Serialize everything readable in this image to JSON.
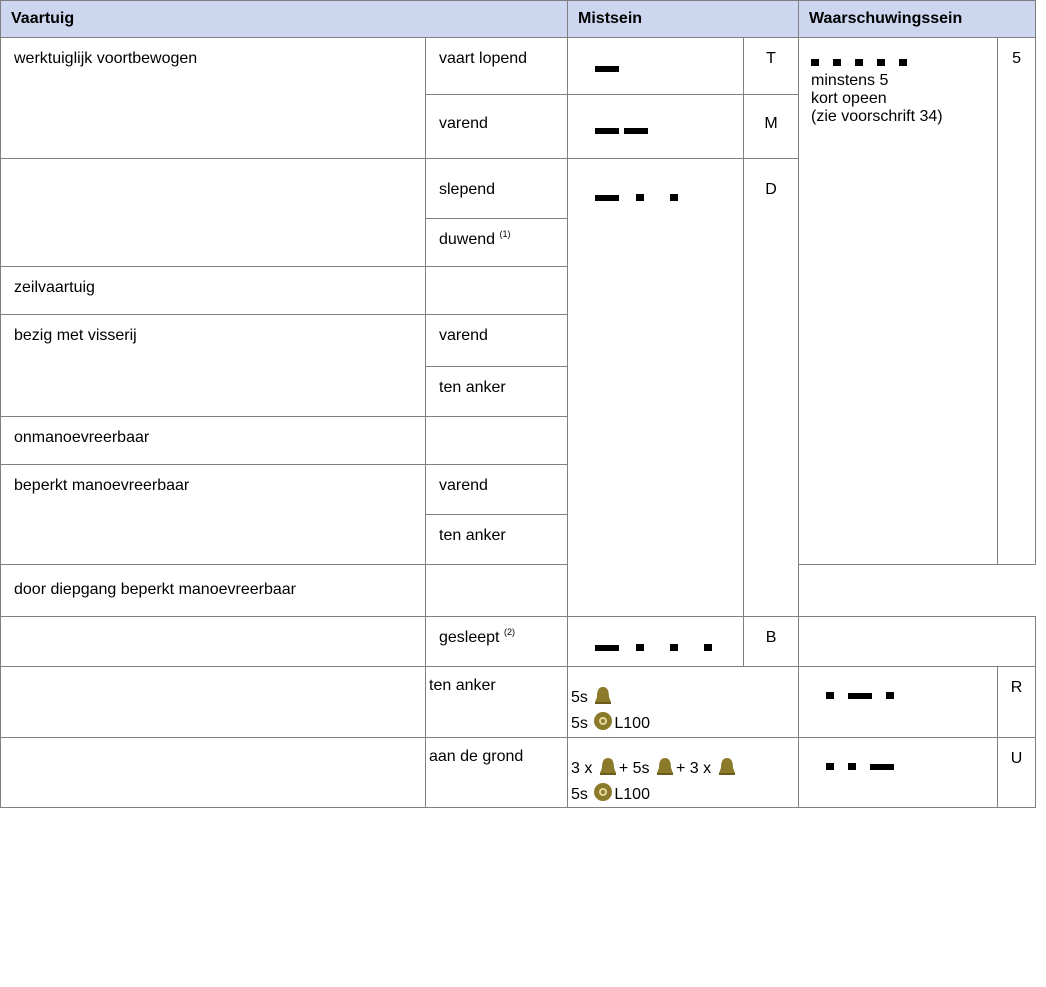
{
  "header": {
    "col_vessel": "Vaartuig",
    "col_fog": "Mistsein",
    "col_warning": "Waarschuwingssein"
  },
  "rows": {
    "r1": {
      "vessel": "werktuiglijk voortbewogen",
      "state": "vaart lopend",
      "letter": "T"
    },
    "r2": {
      "state": "varend",
      "letter": "M"
    },
    "r3": {
      "state": "slepend",
      "letter": "D"
    },
    "r4": {
      "state": "duwend",
      "note": "(1)"
    },
    "r5": {
      "vessel": "zeilvaartuig"
    },
    "r6": {
      "vessel": "bezig met visserij",
      "state": "varend"
    },
    "r7": {
      "state": "ten anker"
    },
    "r8": {
      "vessel": "onmanoevreerbaar"
    },
    "r9": {
      "vessel": "beperkt manoevreerbaar",
      "state": "varend"
    },
    "r10": {
      "state": "ten anker"
    },
    "r11": {
      "vessel": "door diepgang beperkt manoevreerbaar"
    },
    "r12": {
      "state": "gesleept",
      "note": "(2)",
      "letter": "B"
    },
    "r13": {
      "state": "ten anker",
      "line1_prefix": "5s",
      "line2_prefix": "5s",
      "line2_suffix": "L100",
      "letter": "R"
    },
    "r14": {
      "state": "aan de grond",
      "line1_a": "3 x",
      "line1_b": "+ 5s",
      "line1_c": "+ 3 x",
      "line2_prefix": "5s",
      "line2_suffix": "L100",
      "letter": "U"
    }
  },
  "warning": {
    "number": "5",
    "text_1": "minstens 5",
    "text_2": "kort opeen",
    "text_3": "(zie voorschrift 34)"
  },
  "colors": {
    "header_bg": "#ccd6ee",
    "bell": "#8b7a2a",
    "border": "#7f7f7f"
  }
}
